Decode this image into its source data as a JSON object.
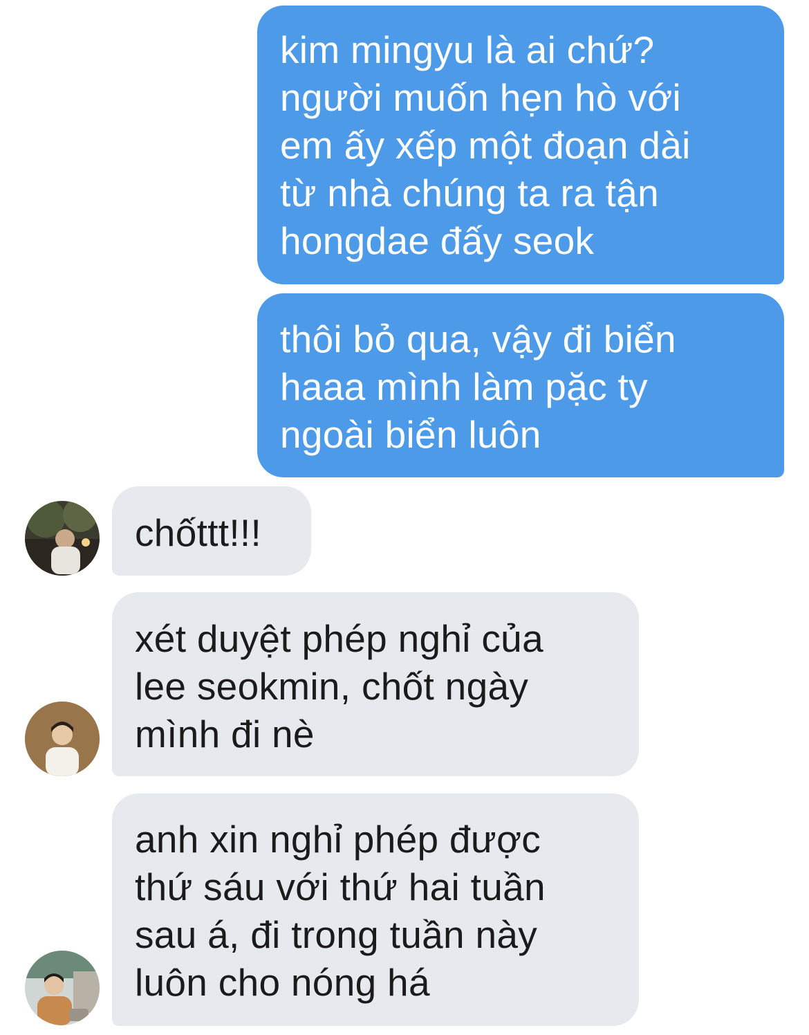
{
  "conversation": {
    "outgoing": [
      {
        "text": "kim mingyu là ai chứ?\nngười muốn hẹn hò với\nem ấy xếp một đoạn dài\ntừ nhà chúng ta ra tận\nhongdae đấy seok"
      },
      {
        "text": "thôi bỏ qua, vậy đi biển\nhaaa mình làm pặc ty\nngoài biển luôn"
      }
    ],
    "incoming": [
      {
        "text": "chốttt!!!",
        "avatar": "contact-photo-1"
      },
      {
        "text": "xét duyệt phép nghỉ của\nlee seokmin, chốt ngày\nmình đi nè",
        "avatar": "contact-photo-2"
      },
      {
        "text": "anh xin nghỉ phép được\nthứ sáu với thứ hai tuần\nsau á, đi trong tuần này\nluôn cho nóng há",
        "avatar": "contact-photo-3"
      }
    ]
  },
  "colors": {
    "outgoing_bubble": "#4d9be8",
    "incoming_bubble": "#e6e9ee",
    "incoming_text": "#1b1b1b",
    "outgoing_text": "#ffffff"
  }
}
